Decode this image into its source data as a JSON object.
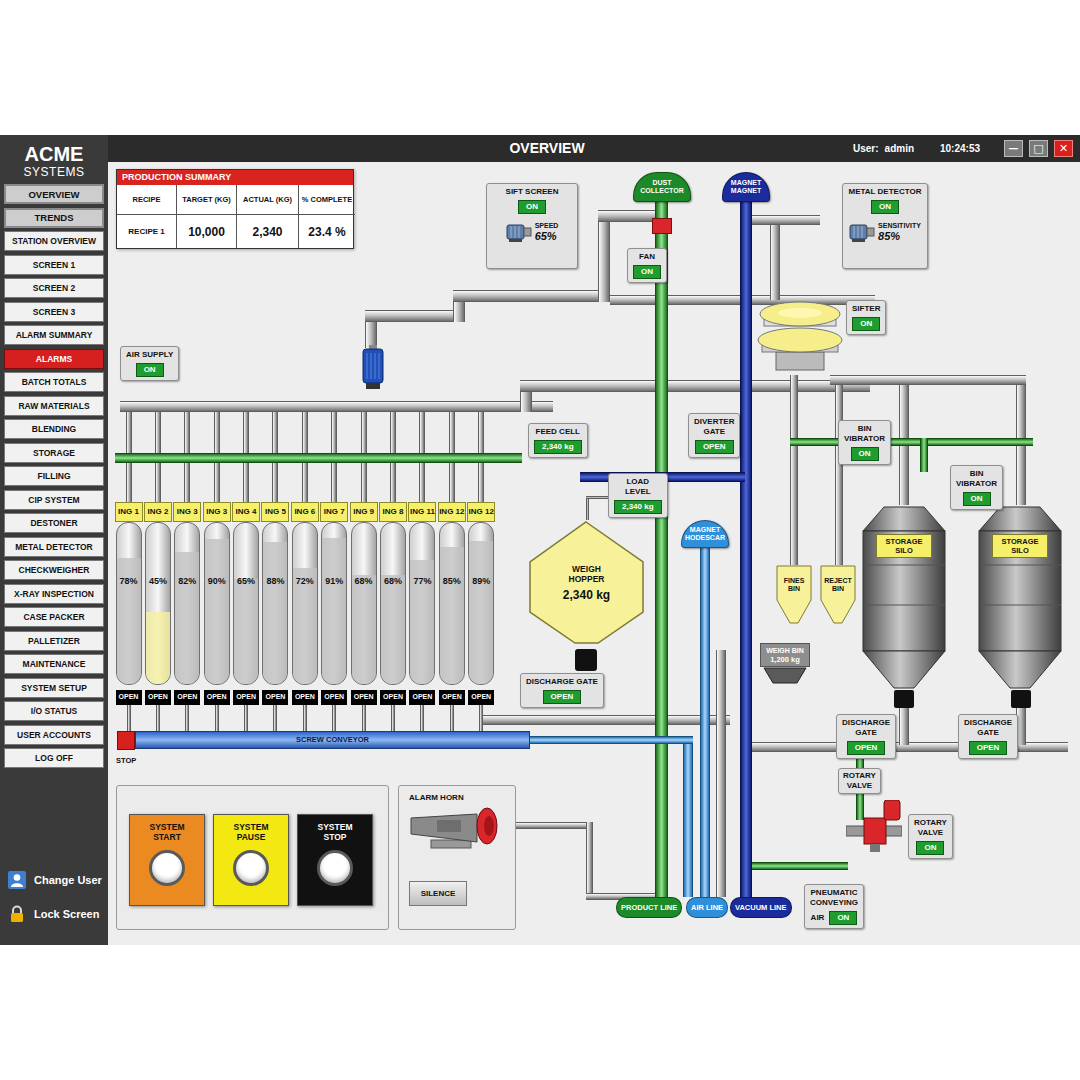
{
  "window": {
    "title": "OVERVIEW",
    "user_label": "User:",
    "user": "admin",
    "time": "10:24:53",
    "controls": [
      "—",
      "□",
      "✕"
    ]
  },
  "brand": {
    "name": "ACME",
    "tagline": "SYSTEMS"
  },
  "sidebar": {
    "items": [
      {
        "label": "OVERVIEW",
        "selected": false,
        "kind": "tab"
      },
      {
        "label": "TRENDS",
        "selected": false,
        "kind": "tab"
      },
      {
        "label": "STATION OVERVIEW",
        "selected": false,
        "kind": "item"
      },
      {
        "label": "SCREEN 1",
        "selected": false,
        "kind": "item"
      },
      {
        "label": "SCREEN 2",
        "selected": false,
        "kind": "item"
      },
      {
        "label": "SCREEN 3",
        "selected": false,
        "kind": "item"
      },
      {
        "label": "ALARM SUMMARY",
        "selected": false,
        "kind": "item"
      },
      {
        "label": "ALARMS",
        "selected": true,
        "kind": "item"
      },
      {
        "label": "BATCH TOTALS",
        "selected": false,
        "kind": "item"
      },
      {
        "label": "RAW MATERIALS",
        "selected": false,
        "kind": "item"
      },
      {
        "label": "BLENDING",
        "selected": false,
        "kind": "item"
      },
      {
        "label": "STORAGE",
        "selected": false,
        "kind": "item"
      },
      {
        "label": "FILLING",
        "selected": false,
        "kind": "item"
      },
      {
        "label": "CIP SYSTEM",
        "selected": false,
        "kind": "item"
      },
      {
        "label": "DESTONER",
        "selected": false,
        "kind": "item"
      },
      {
        "label": "METAL DETECTOR",
        "selected": false,
        "kind": "item"
      },
      {
        "label": "CHECKWEIGHER",
        "selected": false,
        "kind": "item"
      },
      {
        "label": "X-RAY INSPECTION",
        "selected": false,
        "kind": "item"
      },
      {
        "label": "CASE PACKER",
        "selected": false,
        "kind": "item"
      },
      {
        "label": "PALLETIZER",
        "selected": false,
        "kind": "item"
      },
      {
        "label": "MAINTENANCE",
        "selected": false,
        "kind": "item"
      },
      {
        "label": "SYSTEM SETUP",
        "selected": false,
        "kind": "item"
      },
      {
        "label": "I/O STATUS",
        "selected": false,
        "kind": "item"
      },
      {
        "label": "USER ACCOUNTS",
        "selected": false,
        "kind": "item"
      },
      {
        "label": "LOG OFF",
        "selected": false,
        "kind": "item"
      }
    ],
    "footer": [
      {
        "label": "Change User"
      },
      {
        "label": "Lock Screen"
      }
    ]
  },
  "production_summary": {
    "title": "PRODUCTION SUMMARY",
    "columns": [
      "RECIPE",
      "TARGET (KG)",
      "ACTUAL (KG)",
      "% COMPLETE"
    ],
    "rows": [
      [
        "RECIPE 1",
        "10,000",
        "2,340",
        "23.4 %"
      ]
    ]
  },
  "status_boxes": [
    {
      "lines": [
        "SIFT SCREEN"
      ],
      "value": "ON",
      "on": true,
      "sub": {
        "label": "SPEED",
        "value": "65%"
      }
    },
    {
      "lines": [
        "FAN"
      ],
      "value": "ON",
      "on": true
    },
    {
      "lines": [
        "METAL DETECTOR"
      ],
      "value": "ON",
      "on": true,
      "sub": {
        "label": "SENSITIVITY",
        "value": "85%"
      }
    },
    {
      "lines": [
        "SIFTER"
      ],
      "value": "ON",
      "on": true
    },
    {
      "lines": [
        "AIR SUPPLY"
      ],
      "value": "ON",
      "on": true
    },
    {
      "lines": [
        "FEED CELL"
      ],
      "value": "2,340 kg",
      "on": true
    },
    {
      "lines": [
        "DIVERTER",
        "GATE"
      ],
      "value": "OPEN",
      "on": true
    },
    {
      "lines": [
        "BIN",
        "VIBRATOR"
      ],
      "value": "ON",
      "on": true
    },
    {
      "lines": [
        "BIN",
        "VIBRATOR"
      ],
      "value": "ON",
      "on": true
    },
    {
      "lines": [
        "LOAD",
        "LEVEL"
      ],
      "value": "2,340 kg",
      "on": true
    },
    {
      "lines": [
        "DISCHARGE GATE"
      ],
      "value": "OPEN",
      "on": true
    },
    {
      "lines": [
        "DISCHARGE",
        "GATE"
      ],
      "value": "OPEN",
      "on": true
    },
    {
      "lines": [
        "DISCHARGE",
        "GATE"
      ],
      "value": "OPEN",
      "on": true
    },
    {
      "lines": [
        "ROTARY",
        "VALVE"
      ],
      "value": "ON",
      "on": true
    },
    {
      "lines": [
        "PNEUMATIC",
        "CONVEYING"
      ],
      "prefix": "AIR",
      "value": "ON",
      "on": true
    }
  ],
  "pipe_caps": [
    {
      "lines": [
        "DUST",
        "COLLECTOR"
      ],
      "color": "#1c8a28"
    },
    {
      "lines": [
        "MAGNET",
        "MAGNET"
      ],
      "color": "#1a2c9c"
    },
    {
      "lines": [
        "MAGNET",
        "HODESCAR"
      ],
      "color": "#2f8fd8"
    }
  ],
  "line_labels": [
    {
      "label": "PRODUCT LINE",
      "color": "#1c8a28"
    },
    {
      "label": "AIR LINE",
      "color": "#2f8fd8"
    },
    {
      "label": "VACUUM LINE",
      "color": "#1a2c9c"
    }
  ],
  "ingredients": [
    {
      "label": "ING 1",
      "reading": "78%",
      "level": 0.78,
      "color": "#c2c2c2",
      "gate": "OPEN"
    },
    {
      "label": "ING 2",
      "reading": "45%",
      "level": 0.45,
      "color": "#f4f0a0",
      "gate": "OPEN"
    },
    {
      "label": "ING 3",
      "reading": "82%",
      "level": 0.82,
      "color": "#c2c2c2",
      "gate": "OPEN"
    },
    {
      "label": "ING 3",
      "reading": "90%",
      "level": 0.9,
      "color": "#c2c2c2",
      "gate": "OPEN"
    },
    {
      "label": "ING 4",
      "reading": "65%",
      "level": 0.65,
      "color": "#c2c2c2",
      "gate": "OPEN"
    },
    {
      "label": "ING 5",
      "reading": "88%",
      "level": 0.88,
      "color": "#c2c2c2",
      "gate": "OPEN"
    },
    {
      "label": "ING 6",
      "reading": "72%",
      "level": 0.72,
      "color": "#c2c2c2",
      "gate": "OPEN"
    },
    {
      "label": "ING 7",
      "reading": "91%",
      "level": 0.91,
      "color": "#c2c2c2",
      "gate": "OPEN"
    },
    {
      "label": "ING 9",
      "reading": "68%",
      "level": 0.68,
      "color": "#c2c2c2",
      "gate": "OPEN"
    },
    {
      "label": "ING 8",
      "reading": "68%",
      "level": 0.68,
      "color": "#c2c2c2",
      "gate": "OPEN"
    },
    {
      "label": "ING 11",
      "reading": "77%",
      "level": 0.77,
      "color": "#c2c2c2",
      "gate": "OPEN"
    },
    {
      "label": "ING 12",
      "reading": "85%",
      "level": 0.85,
      "color": "#c2c2c2",
      "gate": "OPEN"
    },
    {
      "label": "ING 12",
      "reading": "89%",
      "level": 0.89,
      "color": "#c2c2c2",
      "gate": "OPEN"
    }
  ],
  "weigh_hopper": {
    "lines": [
      "WEIGH",
      "HOPPER"
    ],
    "reading": "2,340 kg"
  },
  "weigh_bin": {
    "title": "WEIGH BIN",
    "reading": "1,200 kg"
  },
  "bins": [
    {
      "lines": [
        "FINES",
        "BIN"
      ]
    },
    {
      "lines": [
        "REJECT",
        "BIN"
      ]
    }
  ],
  "silos": [
    {
      "lines": [
        "STORAGE",
        "SILO"
      ]
    },
    {
      "lines": [
        "STORAGE",
        "SILO"
      ]
    }
  ],
  "screw_conveyor": {
    "label": "SCREW CONVEYOR",
    "stop_label": "STOP"
  },
  "rotary_valve": {
    "lines": [
      "ROTARY",
      "VALVE"
    ]
  },
  "controls": [
    {
      "lines": [
        "SYSTEM",
        "START"
      ],
      "color": "#ec8a22"
    },
    {
      "lines": [
        "SYSTEM",
        "PAUSE"
      ],
      "color": "#f3e812"
    },
    {
      "lines": [
        "SYSTEM",
        "STOP"
      ],
      "color": "#111111"
    }
  ],
  "alarm_horn": {
    "title": "ALARM HORN",
    "button": "SILENCE"
  }
}
